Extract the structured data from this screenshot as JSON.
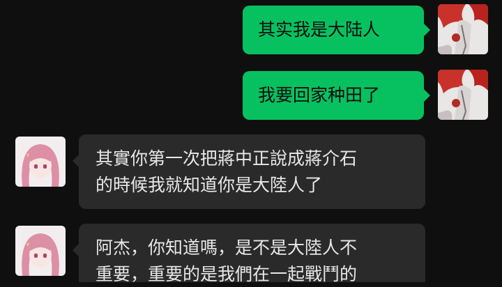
{
  "messages": [
    {
      "side": "right",
      "text": "其实我是大陆人",
      "avatar_icon": "red-hair-character-avatar-icon"
    },
    {
      "side": "right",
      "text": "我要回家种田了",
      "avatar_icon": "red-hair-character-avatar-icon"
    },
    {
      "side": "left",
      "lines": [
        "其實你第一次把蔣中正說成蔣介石",
        "的時候我就知道你是大陸人了"
      ],
      "avatar_icon": "pink-hair-girl-avatar-icon"
    },
    {
      "side": "left",
      "lines": [
        "阿杰，你知道嗎，是不是大陸人不",
        "重要，重要的是我們在一起戰鬥的"
      ],
      "avatar_icon": "pink-hair-girl-avatar-icon"
    }
  ],
  "colors": {
    "background": "#0f0f0f",
    "outgoing_bubble": "#07c160",
    "incoming_bubble": "#2a2a2a"
  }
}
